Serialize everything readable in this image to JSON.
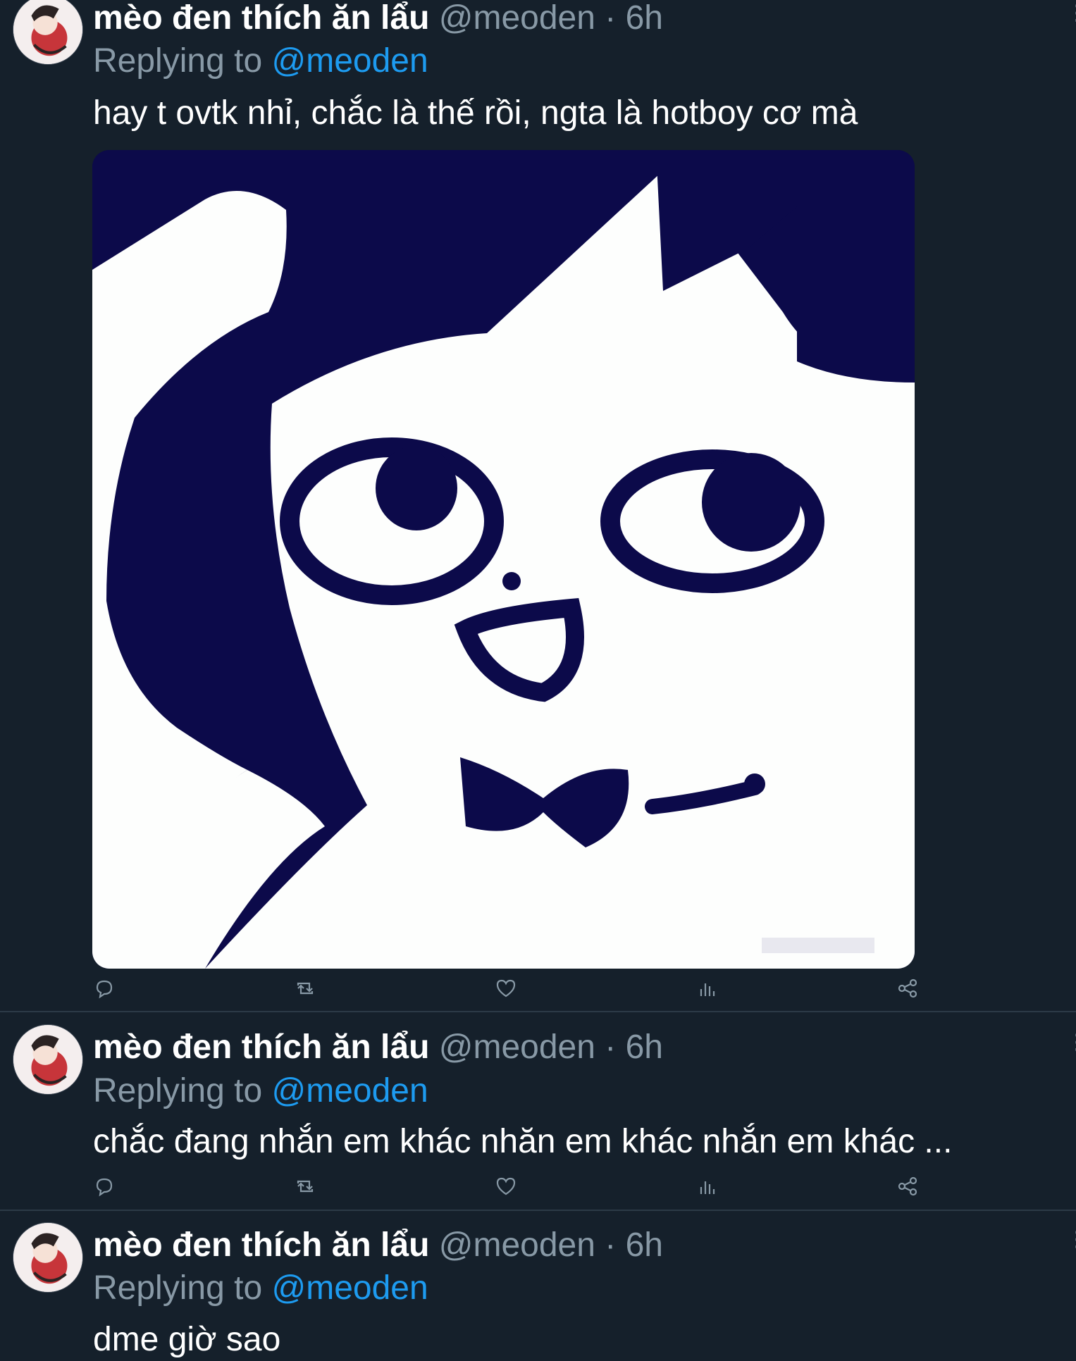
{
  "tweets": [
    {
      "name": "mèo đen thích ăn lẩu",
      "handle": "@meoden",
      "dot": "·",
      "time": "6h",
      "replying_label": "Replying to",
      "replying_to": "@meoden",
      "text": "hay t ovtk nhỉ, chắc là thế rồi, ngta là hotboy cơ mà",
      "has_media": true
    },
    {
      "name": "mèo đen thích ăn lẩu",
      "handle": "@meoden",
      "dot": "·",
      "time": "6h",
      "replying_label": "Replying to",
      "replying_to": "@meoden",
      "text": "chắc đang nhắn em khác nhăn em khác nhắn em khác ..."
    },
    {
      "name": "mèo đen thích ăn lẩu",
      "handle": "@meoden",
      "dot": "·",
      "time": "6h",
      "replying_label": "Replying to",
      "replying_to": "@meoden",
      "text": "dme giờ sao"
    }
  ],
  "icons": [
    "reply-icon",
    "retweet-icon",
    "like-icon",
    "analytics-icon",
    "share-icon",
    "more-icon"
  ],
  "colors": {
    "background": "#15202b",
    "secondary_text": "#8899a6",
    "mention": "#1d9bf0",
    "divider": "#2c3a47"
  }
}
